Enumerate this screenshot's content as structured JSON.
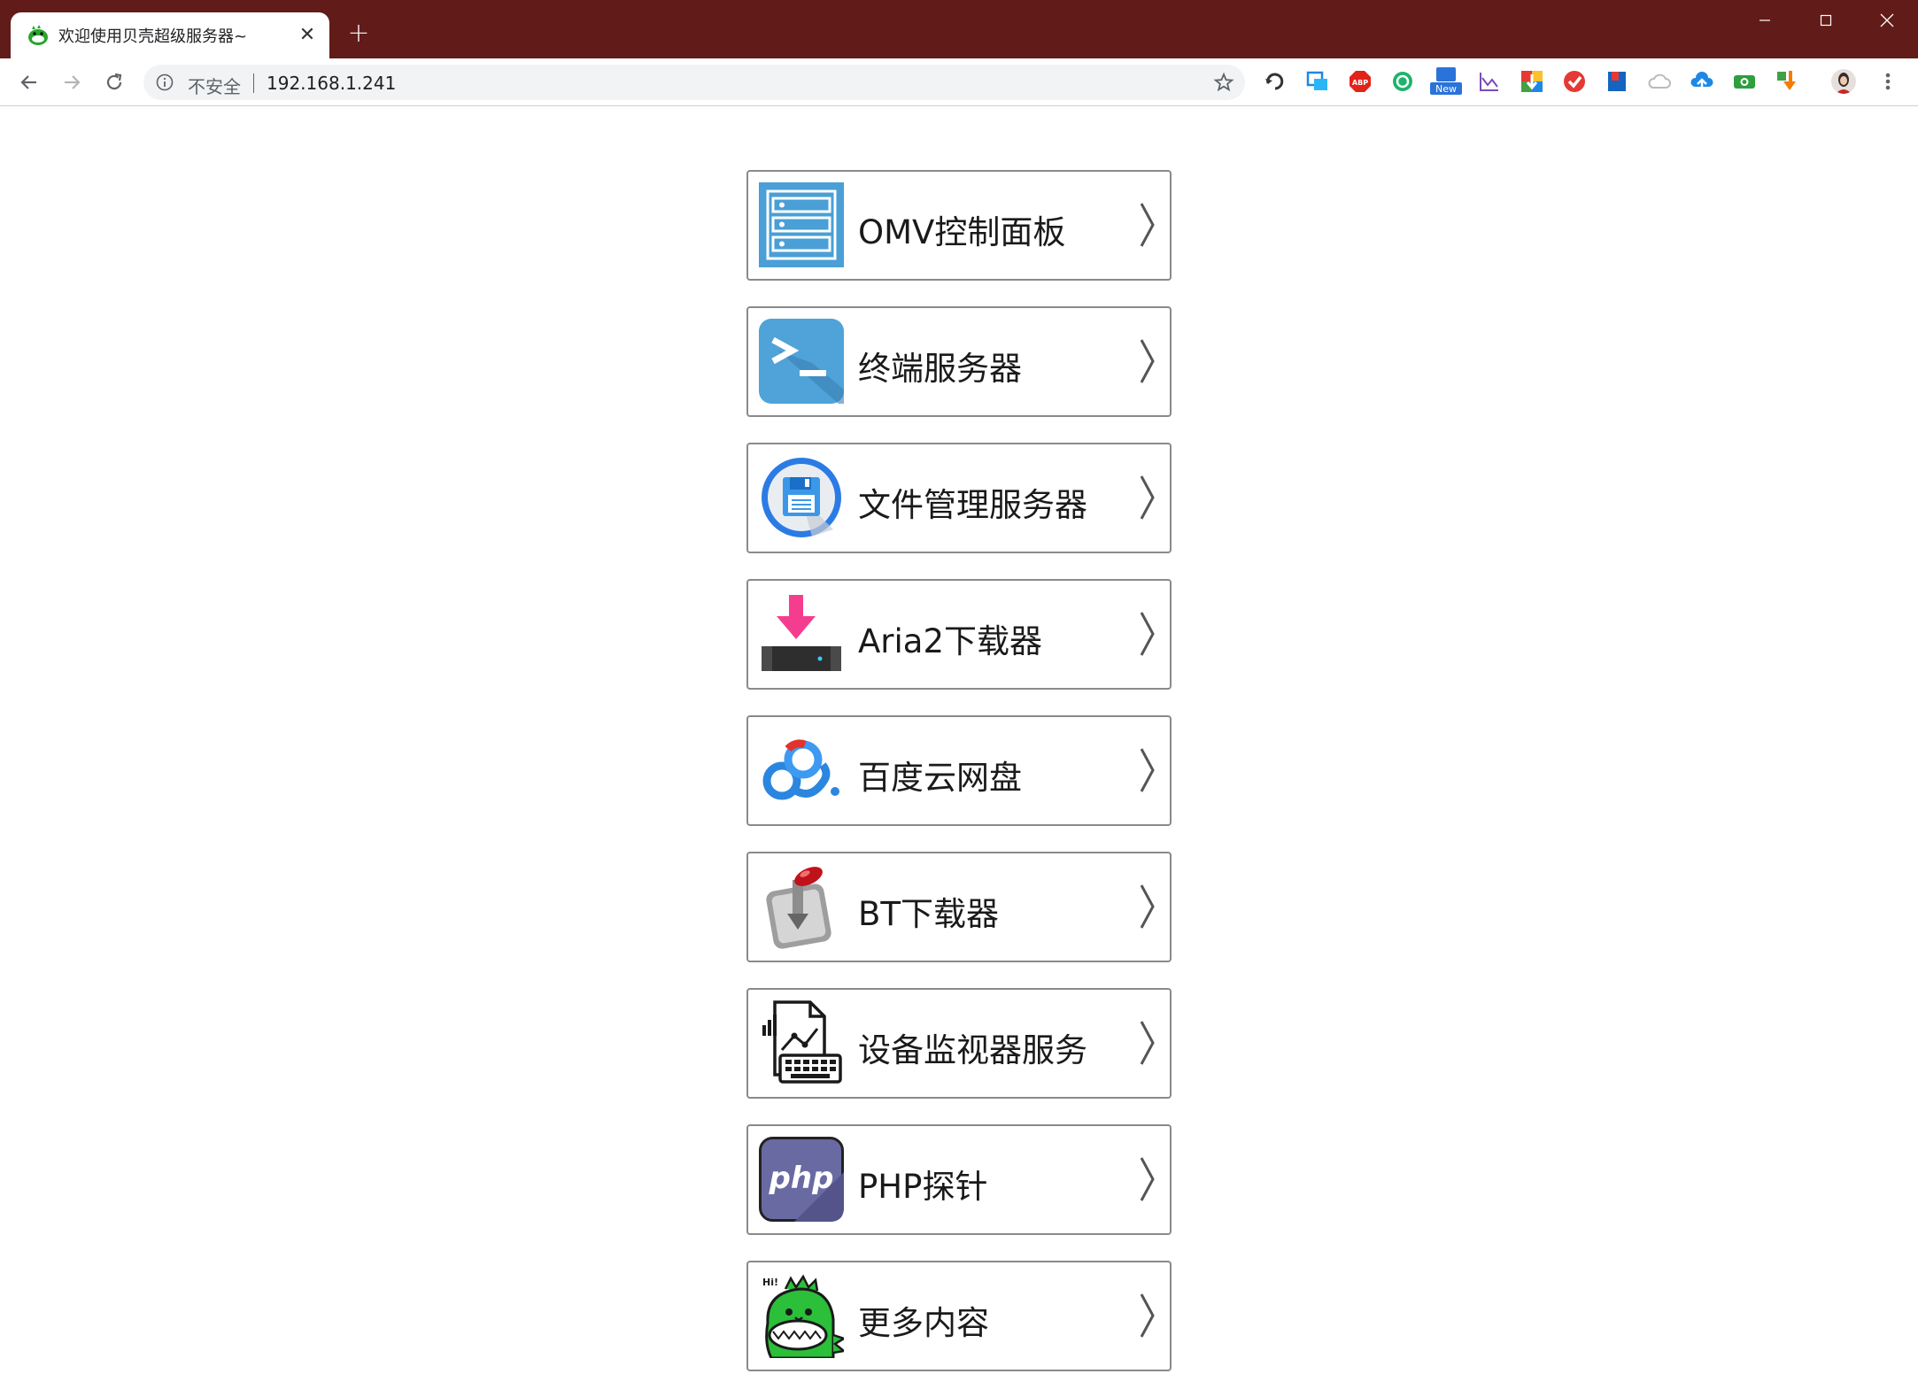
{
  "browser": {
    "tab_title": "欢迎使用贝壳超级服务器~",
    "tab_close": "✕",
    "new_tab": "+",
    "security_label": "不安全",
    "url": "192.168.1.241",
    "extension_new_badge": "New",
    "frame_color": "#611b18"
  },
  "menu": {
    "items": [
      {
        "label": "OMV控制面板",
        "icon": "server-icon"
      },
      {
        "label": "终端服务器",
        "icon": "terminal-icon"
      },
      {
        "label": "文件管理服务器",
        "icon": "floppy-disk-icon"
      },
      {
        "label": "Aria2下载器",
        "icon": "download-arrow-icon"
      },
      {
        "label": "百度云网盘",
        "icon": "baidu-cloud-icon"
      },
      {
        "label": "BT下载器",
        "icon": "transmission-icon"
      },
      {
        "label": "设备监视器服务",
        "icon": "monitor-report-icon"
      },
      {
        "label": "PHP探针",
        "icon": "php-icon"
      },
      {
        "label": "更多内容",
        "icon": "dinosaur-icon"
      }
    ]
  }
}
